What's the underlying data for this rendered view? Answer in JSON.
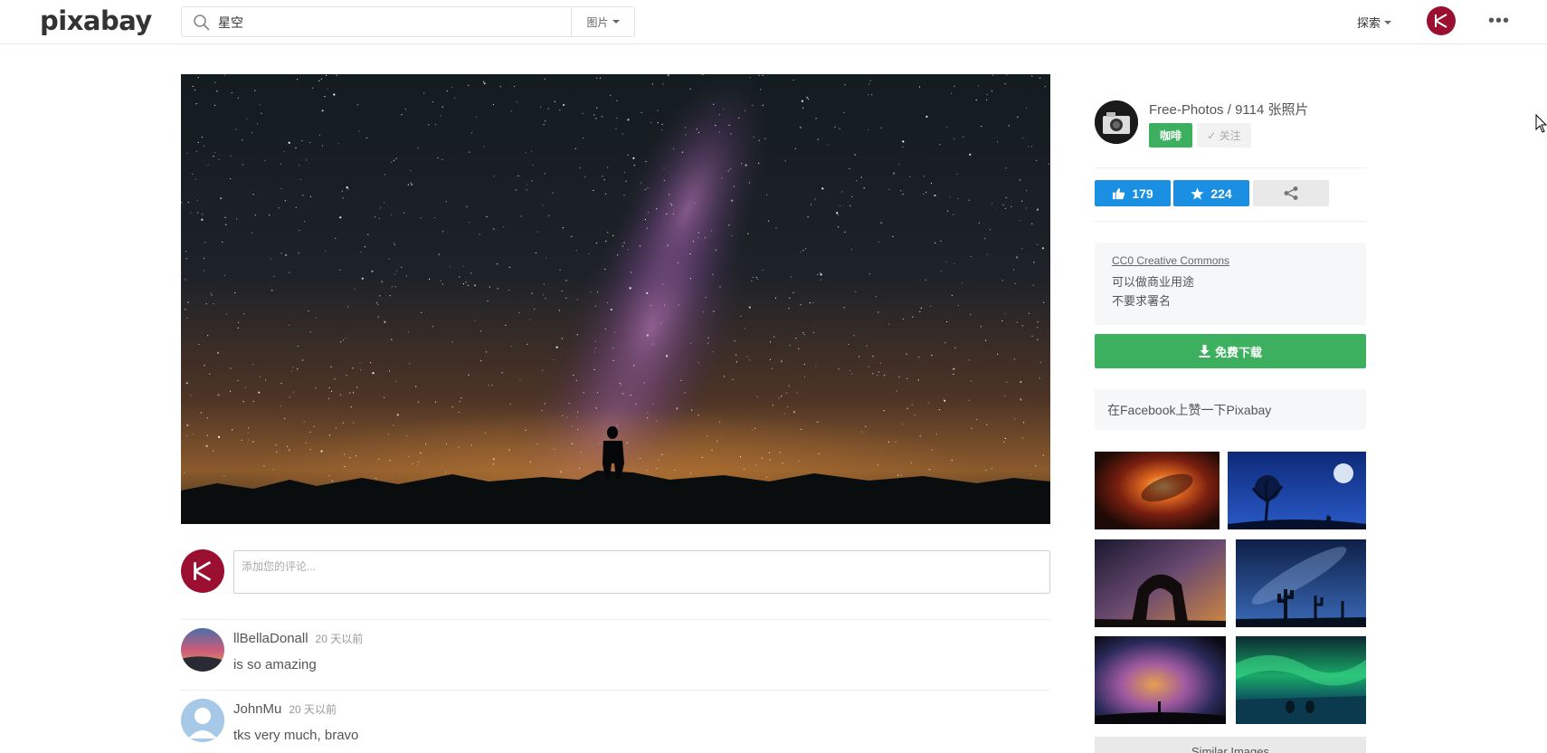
{
  "header": {
    "logo": "pixabay",
    "search_value": "星空",
    "search_type": "图片",
    "explore_label": "探索"
  },
  "main_image": {
    "alt": "星空"
  },
  "comments": {
    "placeholder": "添加您的评论...",
    "items": [
      {
        "author": "llBellaDonall",
        "time": "20 天以前",
        "text": "is so amazing"
      },
      {
        "author": "JohnMu",
        "time": "20 天以前",
        "text": "tks very much, bravo"
      }
    ]
  },
  "sidebar": {
    "uploader": {
      "name": "Free-Photos",
      "photo_count": "9114 张照片"
    },
    "coffee_label": "咖啡",
    "follow_label": "✓ 关注",
    "likes": "179",
    "favorites": "224",
    "license": {
      "link": "CC0 Creative Commons",
      "line1": "可以做商业用途",
      "line2": "不要求署名"
    },
    "download_label": "免费下载",
    "facebook_label": "在Facebook上赞一下Pixabay",
    "similar_label": "Similar Images"
  },
  "colors": {
    "green": "#3cb05e",
    "blue": "#1b8fe2",
    "avatar_red": "#9b1030"
  }
}
